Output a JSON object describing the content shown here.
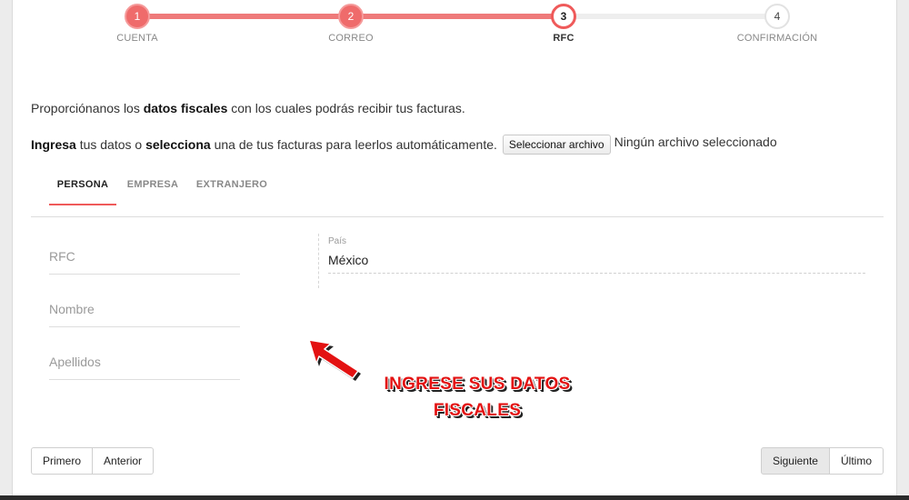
{
  "stepper": {
    "steps": [
      {
        "number": "1",
        "label": "CUENTA",
        "state": "done"
      },
      {
        "number": "2",
        "label": "CORREO",
        "state": "done"
      },
      {
        "number": "3",
        "label": "RFC",
        "state": "active"
      },
      {
        "number": "4",
        "label": "CONFIRMACIÓN",
        "state": "todo"
      }
    ]
  },
  "intro": {
    "before": "Proporciónanos los ",
    "bold": "datos fiscales",
    "after": " con los cuales podrás recibir tus facturas."
  },
  "file_line": {
    "bold1": "Ingresa",
    "mid1": " tus datos o ",
    "bold2": "selecciona",
    "mid2": " una de tus facturas para leerlos automáticamente.",
    "button_label": "Seleccionar archivo",
    "status": "Ningún archivo seleccionado"
  },
  "tabs": [
    {
      "label": "PERSONA",
      "active": true
    },
    {
      "label": "EMPRESA",
      "active": false
    },
    {
      "label": "EXTRANJERO",
      "active": false
    }
  ],
  "form": {
    "rfc_placeholder": "RFC",
    "nombre_placeholder": "Nombre",
    "apellidos_placeholder": "Apellidos",
    "country_label": "País",
    "country_value": "México"
  },
  "annotation": {
    "line1": "INGRESE SUS DATOS",
    "line2": "FISCALES"
  },
  "nav": {
    "first": "Primero",
    "previous": "Anterior",
    "next": "Siguiente",
    "last": "Último"
  },
  "colors": {
    "accent": "#ef5a5a",
    "annotation": "#e31212"
  }
}
